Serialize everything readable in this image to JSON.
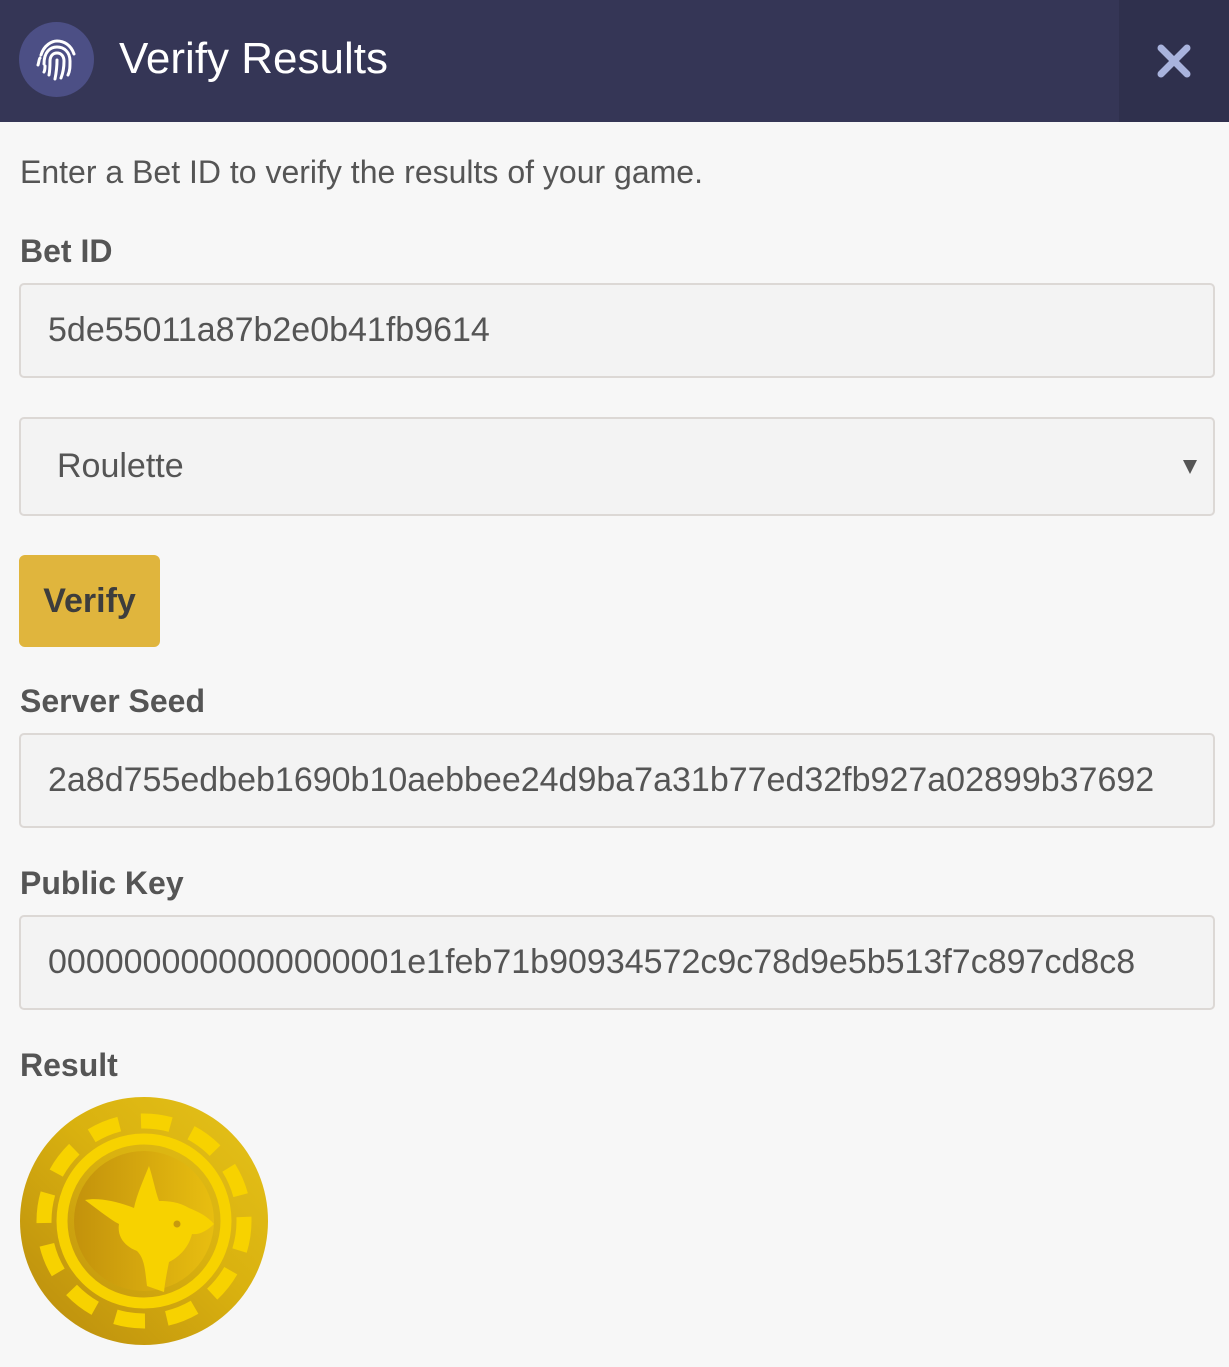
{
  "header": {
    "title": "Verify Results",
    "icon": "fingerprint-icon",
    "close_icon": "close-icon",
    "colors": {
      "bar": "#353656",
      "icon_bg": "#4c4f85",
      "close_bg": "#2f304d",
      "close_x": "#a9b3dd"
    }
  },
  "intro": "Enter a Bet ID to verify the results of your game.",
  "bet_id": {
    "label": "Bet ID",
    "value": "5de55011a87b2e0b41fb9614"
  },
  "game_select": {
    "selected": "Roulette"
  },
  "verify_button": {
    "label": "Verify",
    "color": "#e0b53d"
  },
  "server_seed": {
    "label": "Server Seed",
    "value": "2a8d755edbeb1690b10aebbee24d9ba7a31b77ed32fb927a02899b37692"
  },
  "public_key": {
    "label": "Public Key",
    "value": "0000000000000000001e1feb71b90934572c9c78d9e5b513f7c897cd8c8"
  },
  "result": {
    "label": "Result",
    "icon": "gold-kangaroo-chip-icon"
  }
}
